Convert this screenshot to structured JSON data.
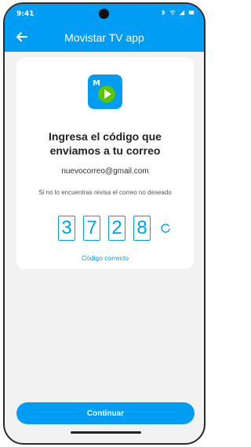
{
  "status_bar": {
    "time": "9:41"
  },
  "app_bar": {
    "title": "Movistar TV app"
  },
  "card": {
    "heading_line1": "Ingresa el código que",
    "heading_line2": "enviamos a tu correo",
    "email": "nuevocorreo@gmail.com",
    "hint": "Si no lo encuentras revisa el correo no deseado",
    "code_digits": [
      "3",
      "7",
      "2",
      "8"
    ],
    "code_status": "Código correcto"
  },
  "footer": {
    "continue_label": "Continuar"
  },
  "colors": {
    "brand": "#019df4",
    "background": "#f2f2f2",
    "card": "#ffffff"
  },
  "icons": [
    "back-arrow-icon",
    "movistar-tv-app-icon",
    "refresh-icon",
    "bluetooth-icon",
    "wifi-icon",
    "signal-icon",
    "battery-icon"
  ]
}
